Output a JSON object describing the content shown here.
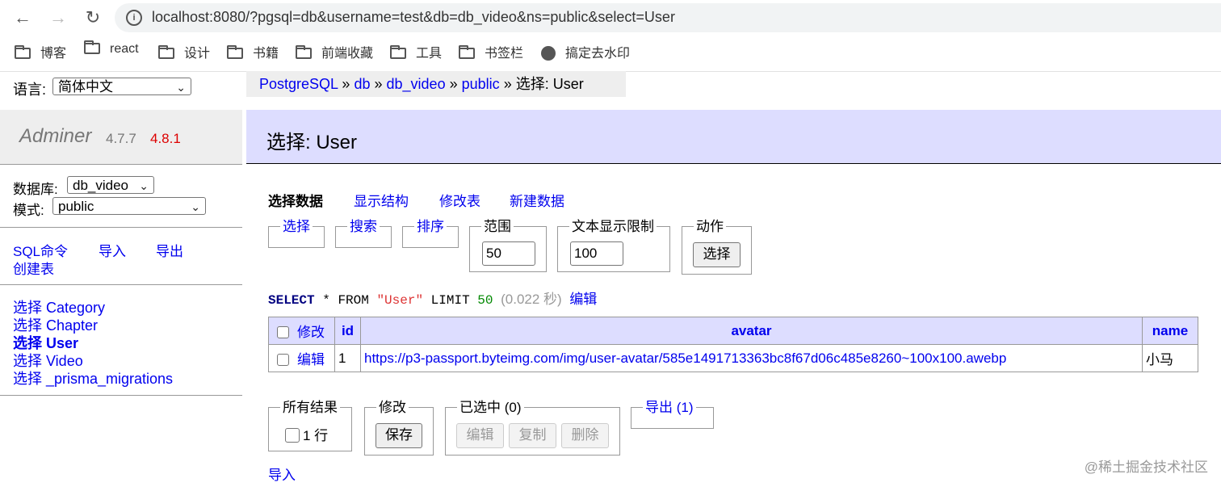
{
  "browser": {
    "url": "localhost:8080/?pgsql=db&username=test&db=db_video&ns=public&select=User",
    "bookmarks": [
      "博客",
      "react",
      "设计",
      "书籍",
      "前端收藏",
      "工具",
      "书签栏",
      "搞定去水印"
    ]
  },
  "lang": {
    "label": "语言:",
    "value": "简体中文"
  },
  "brand": {
    "name": "Adminer",
    "version": "4.7.7",
    "new_version": "4.8.1"
  },
  "breadcrumb": {
    "items": [
      "PostgreSQL",
      "db",
      "db_video",
      "public"
    ],
    "sep": "»",
    "current": "选择: User"
  },
  "heading": "选择: User",
  "sidebar": {
    "db_label": "数据库:",
    "db_value": "db_video",
    "schema_label": "模式:",
    "schema_value": "public",
    "links": [
      "SQL命令",
      "导入",
      "导出",
      "创建表"
    ],
    "tables": [
      "选择 Category",
      "选择 Chapter",
      "选择 User",
      "选择 Video",
      "选择 _prisma_migrations"
    ]
  },
  "tabs": [
    "选择数据",
    "显示结构",
    "修改表",
    "新建数据"
  ],
  "filters": {
    "select": "选择",
    "search": "搜索",
    "sort": "排序",
    "limit_label": "范围",
    "limit_value": "50",
    "text_limit_label": "文本显示限制",
    "text_limit_value": "100",
    "action_label": "动作",
    "action_button": "选择"
  },
  "query": {
    "kw1": "SELECT",
    "star": "*",
    "kw2": "FROM",
    "table": "\"User\"",
    "kw3": "LIMIT",
    "limit": "50",
    "time": "(0.022 秒)",
    "edit": "编辑"
  },
  "table": {
    "headers": [
      "修改",
      "id",
      "avatar",
      "name"
    ],
    "rows": [
      {
        "edit": "编辑",
        "id": "1",
        "avatar": "https://p3-passport.byteimg.com/img/user-avatar/585e1491713363bc8f67d06c485e8260~100x100.awebp",
        "name": "小马"
      }
    ]
  },
  "bottom": {
    "all_results_label": "所有结果",
    "rows_count": "1 行",
    "modify_label": "修改",
    "save_button": "保存",
    "selected_label": "已选中 (0)",
    "edit_button": "编辑",
    "copy_button": "复制",
    "delete_button": "删除",
    "export_label": "导出 (1)",
    "import_link": "导入"
  },
  "watermark": "@稀土掘金技术社区"
}
